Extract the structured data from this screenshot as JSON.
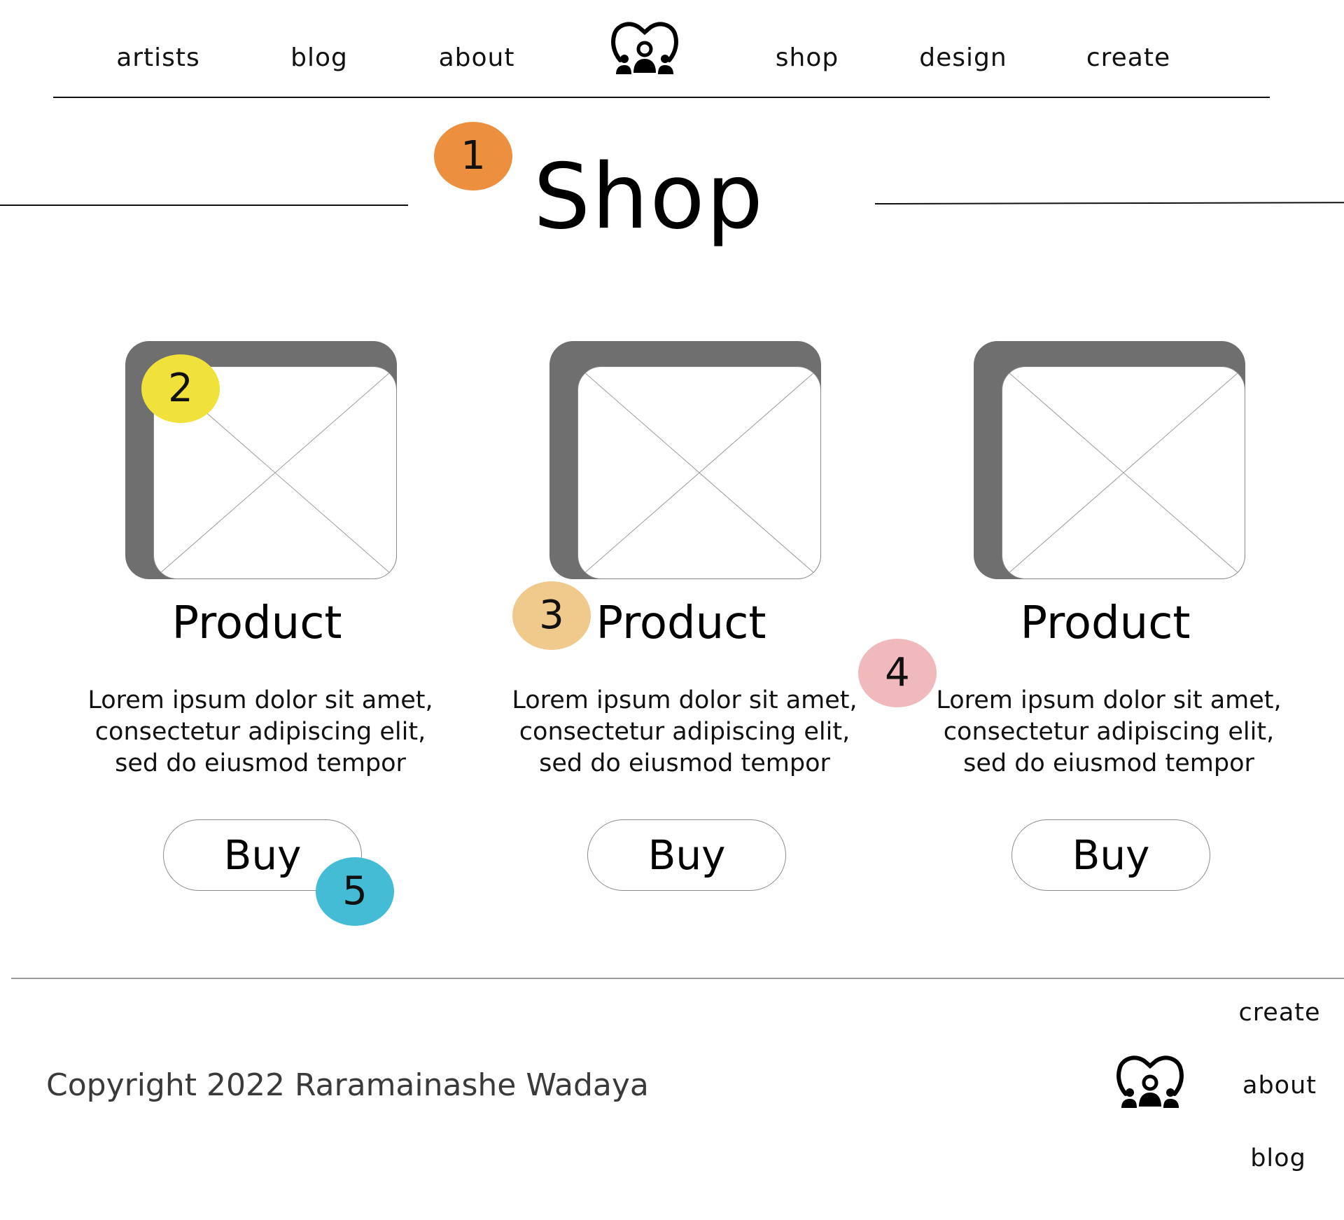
{
  "nav": {
    "left_items": [
      {
        "label": "artists"
      },
      {
        "label": "blog"
      },
      {
        "label": "about"
      }
    ],
    "right_items": [
      {
        "label": "shop"
      },
      {
        "label": "design"
      },
      {
        "label": "create"
      }
    ],
    "logo_icon": "heart-people-logo-icon"
  },
  "page": {
    "title": "Shop"
  },
  "annotations": [
    {
      "number": "1",
      "color": "#ec8f3e"
    },
    {
      "number": "2",
      "color": "#f0e23a"
    },
    {
      "number": "3",
      "color": "#f0c98c"
    },
    {
      "number": "4",
      "color": "#f0b9bb"
    },
    {
      "number": "5",
      "color": "#44bcd6"
    }
  ],
  "products": [
    {
      "image_icon": "image-placeholder-icon",
      "name": "Product",
      "description_lines": [
        "Lorem ipsum dolor sit amet,",
        "consectetur adipiscing elit,",
        "sed do eiusmod tempor"
      ],
      "buy_label": "Buy"
    },
    {
      "image_icon": "image-placeholder-icon",
      "name": "Product",
      "description_lines": [
        "Lorem ipsum dolor sit amet,",
        "consectetur adipiscing elit,",
        "sed do eiusmod tempor"
      ],
      "buy_label": "Buy"
    },
    {
      "image_icon": "image-placeholder-icon",
      "name": "Product",
      "description_lines": [
        "Lorem ipsum dolor sit amet,",
        "consectetur adipiscing elit,",
        "sed do eiusmod tempor"
      ],
      "buy_label": "Buy"
    }
  ],
  "footer": {
    "copyright": "Copyright 2022 Raramainashe Wadaya",
    "links": [
      {
        "label": "create"
      },
      {
        "label": "about"
      },
      {
        "label": "blog"
      }
    ],
    "logo_icon": "heart-people-logo-icon"
  },
  "colors": {
    "text": "#111111",
    "image_frame": "#6f6f6f",
    "button_border": "#8c8c8c",
    "footer_text": "#3a3a3a"
  }
}
